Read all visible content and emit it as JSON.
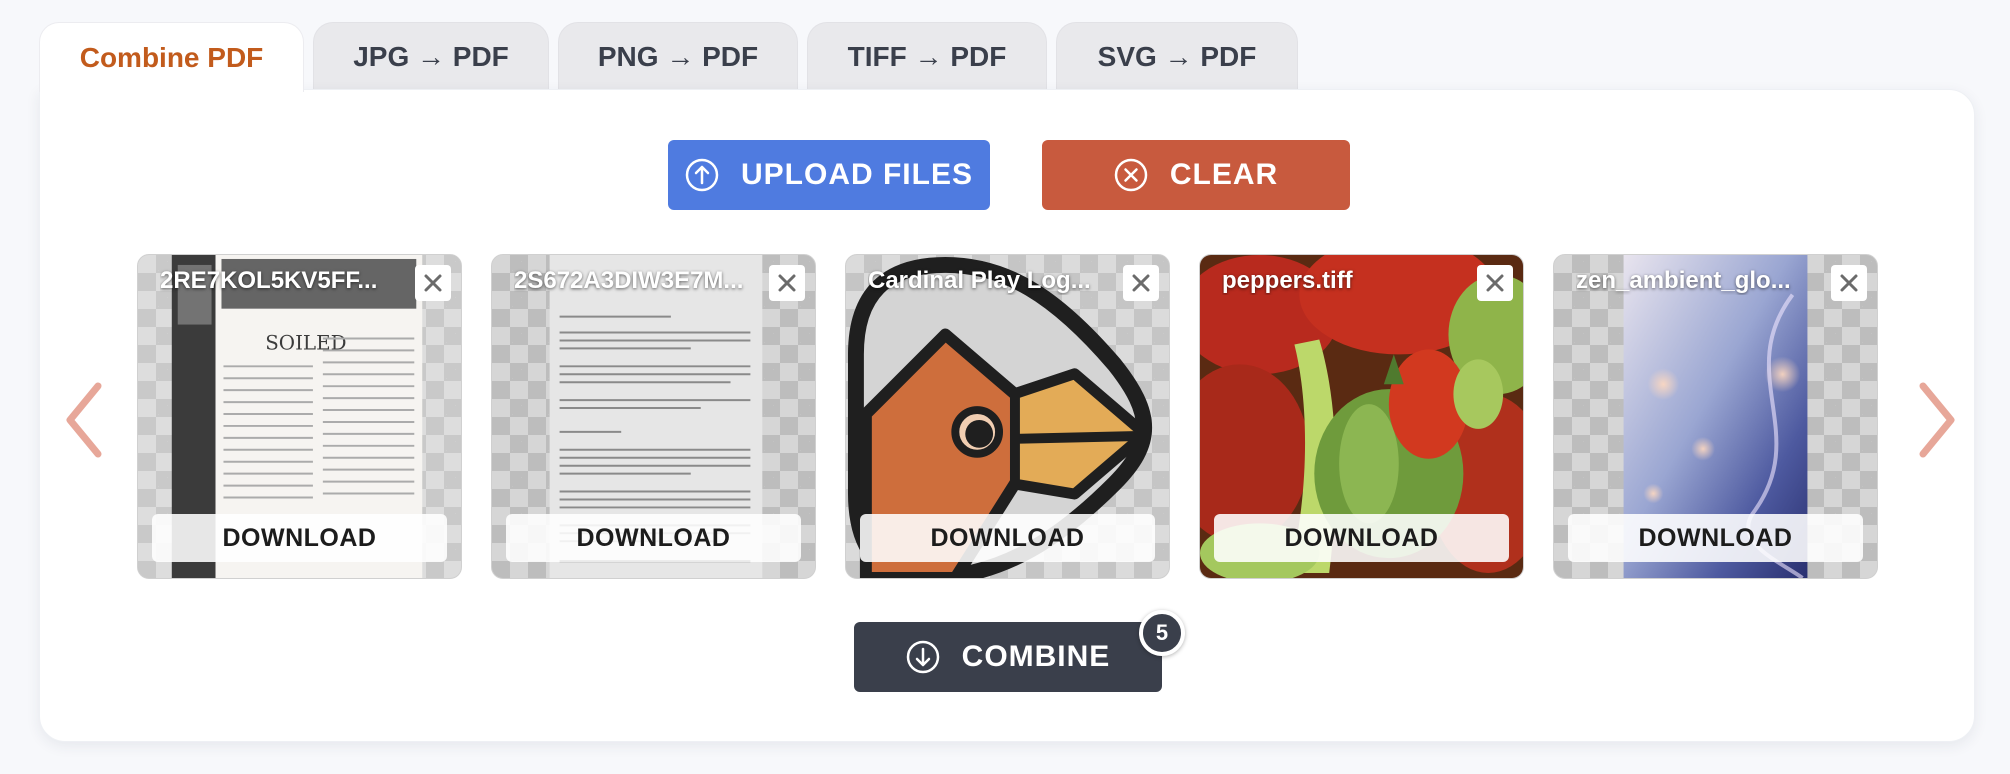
{
  "tabs": [
    {
      "label": "Combine PDF"
    },
    {
      "label": "JPG → PDF"
    },
    {
      "label": "PNG → PDF"
    },
    {
      "label": "TIFF → PDF"
    },
    {
      "label": "SVG → PDF"
    }
  ],
  "actions": {
    "upload_label": "UPLOAD FILES",
    "clear_label": "CLEAR",
    "combine_label": "COMBINE",
    "combine_count": "5"
  },
  "files": [
    {
      "name": "2RE7KOL5KV5FF...",
      "download_label": "DOWNLOAD",
      "preview": "document-newsletter",
      "preview_text": "SOILED"
    },
    {
      "name": "2S672A3DIW3E7M...",
      "download_label": "DOWNLOAD",
      "preview": "document-text-page"
    },
    {
      "name": "Cardinal Play Log...",
      "download_label": "DOWNLOAD",
      "preview": "bird-logo"
    },
    {
      "name": "peppers.tiff",
      "download_label": "DOWNLOAD",
      "preview": "peppers-photo"
    },
    {
      "name": "zen_ambient_glo...",
      "download_label": "DOWNLOAD",
      "preview": "ambient-glow-image"
    }
  ],
  "colors": {
    "active_tab": "#c25b1c",
    "upload": "#4f7be0",
    "clear": "#c85a3e",
    "combine": "#3a3f4b",
    "arrow": "#e7a799"
  }
}
